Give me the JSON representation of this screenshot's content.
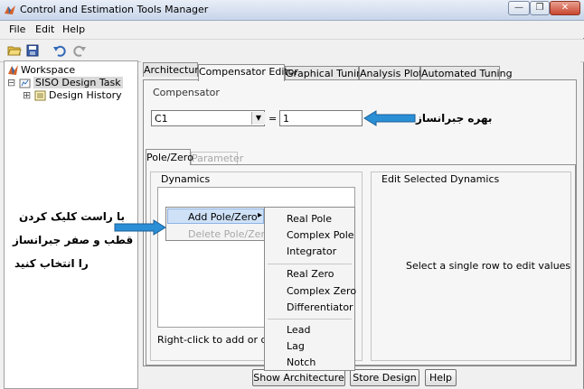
{
  "window": {
    "title": "Control and Estimation Tools Manager",
    "minimize_glyph": "—",
    "restore_glyph": "❐",
    "close_glyph": "✕"
  },
  "menu": {
    "items": [
      "File",
      "Edit",
      "Help"
    ]
  },
  "toolbar": {
    "icons": [
      "open-folder-icon",
      "save-icon",
      "undo-icon",
      "redo-icon"
    ]
  },
  "tree": {
    "root": "Workspace",
    "task": "SISO Design Task",
    "child": "Design History",
    "expand_glyph": "⊞",
    "collapse_glyph": "⊟"
  },
  "tabs": [
    "Architecture",
    "Compensator Editor",
    "Graphical Tuning",
    "Analysis Plots",
    "Automated Tuning"
  ],
  "active_tab": "Compensator Editor",
  "compensator": {
    "label": "Compensator",
    "selected": "C1",
    "equals": "=",
    "value": "1"
  },
  "subtabs": {
    "active": "Pole/Zero",
    "inactive": "Parameter"
  },
  "dynamics": {
    "label": "Dynamics",
    "hint": "Right-click to add or delete"
  },
  "edit_dynamics": {
    "label": "Edit Selected Dynamics",
    "message": "Select a single row to edit values"
  },
  "context_menu": {
    "add": "Add Pole/Zero",
    "delete": "Delete Pole/Zero",
    "submenu_arrow": "▸",
    "items": [
      "Real Pole",
      "Complex Pole",
      "Integrator",
      "Real Zero",
      "Complex Zero",
      "Differentiator",
      "Lead",
      "Lag",
      "Notch"
    ]
  },
  "buttons": {
    "show_architecture": "Show Architecture",
    "store_design": "Store Design",
    "help": "Help"
  },
  "annotations": {
    "gain": "بهره جبرانساز",
    "line1": "با راست کلیک کردن",
    "line2": "قطب و صفر جبرانساز",
    "line3": "را انتخاب کنید"
  },
  "colors": {
    "arrow": "#2b8fd6",
    "title_bar": "#d6e2f3",
    "tree_selected": "#d9d9d9"
  }
}
